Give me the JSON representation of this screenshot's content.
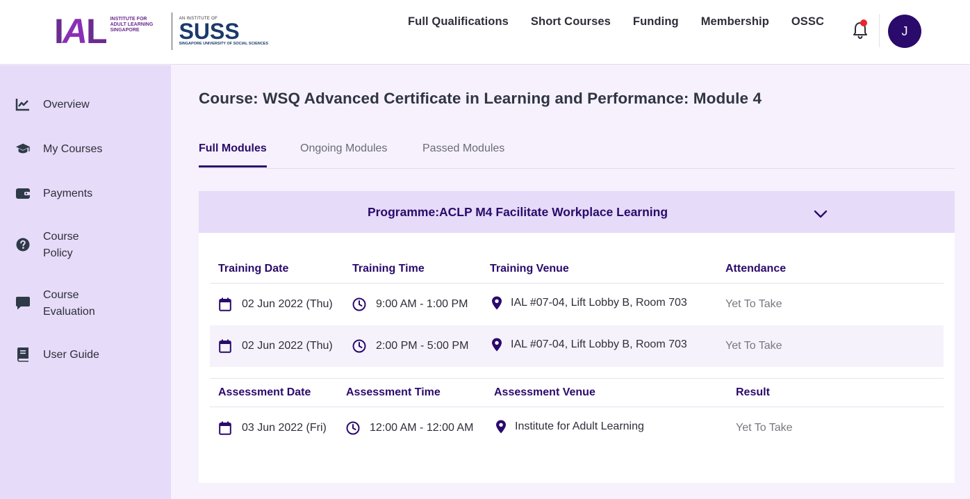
{
  "header": {
    "logo_ial_sub": "INSTITUTE FOR ADULT LEARNING SINGAPORE",
    "logo_suss_top": "AN INSTITUTE OF",
    "logo_suss_word": "SUSS",
    "logo_suss_bottom": "SINGAPORE UNIVERSITY OF SOCIAL SCIENCES",
    "nav": [
      "Full Qualifications",
      "Short Courses",
      "Funding",
      "Membership",
      "OSSC"
    ],
    "avatar_initial": "J",
    "notification_dot_color": "#e8262e",
    "brand_color": "#2a0a6b"
  },
  "sidebar": {
    "items": [
      {
        "label": "Overview",
        "icon": "chart-line-icon"
      },
      {
        "label": "My Courses",
        "icon": "graduation-cap-icon"
      },
      {
        "label": "Payments",
        "icon": "wallet-icon"
      },
      {
        "label": "Course\nPolicy",
        "icon": "question-circle-icon"
      },
      {
        "label": "Course\nEvaluation",
        "icon": "comment-icon"
      },
      {
        "label": "User Guide",
        "icon": "book-icon"
      }
    ]
  },
  "main": {
    "title": "Course: WSQ Advanced Certificate in Learning and Performance: Module 4",
    "tabs": [
      {
        "label": "Full Modules",
        "active": true
      },
      {
        "label": "Ongoing Modules",
        "active": false
      },
      {
        "label": "Passed Modules",
        "active": false
      }
    ],
    "programme": {
      "title": "Programme:ACLP M4 Facilitate Workplace Learning",
      "training": {
        "headers": [
          "Training Date",
          "Training Time",
          "Training Venue",
          "Attendance"
        ],
        "rows": [
          {
            "date": "02 Jun 2022 (Thu)",
            "time": "9:00 AM - 1:00 PM",
            "venue": "IAL #07-04, Lift Lobby B, Room 703",
            "status": "Yet To Take"
          },
          {
            "date": "02 Jun 2022 (Thu)",
            "time": "2:00 PM - 5:00 PM",
            "venue": "IAL #07-04, Lift Lobby B, Room 703",
            "status": "Yet To Take"
          }
        ]
      },
      "assessment": {
        "headers": [
          "Assessment Date",
          "Assessment Time",
          "Assessment Venue",
          "Result"
        ],
        "rows": [
          {
            "date": "03 Jun 2022 (Fri)",
            "time": "12:00 AM - 12:00 AM",
            "venue": "Institute for Adult Learning",
            "status": "Yet To Take"
          }
        ]
      }
    }
  }
}
